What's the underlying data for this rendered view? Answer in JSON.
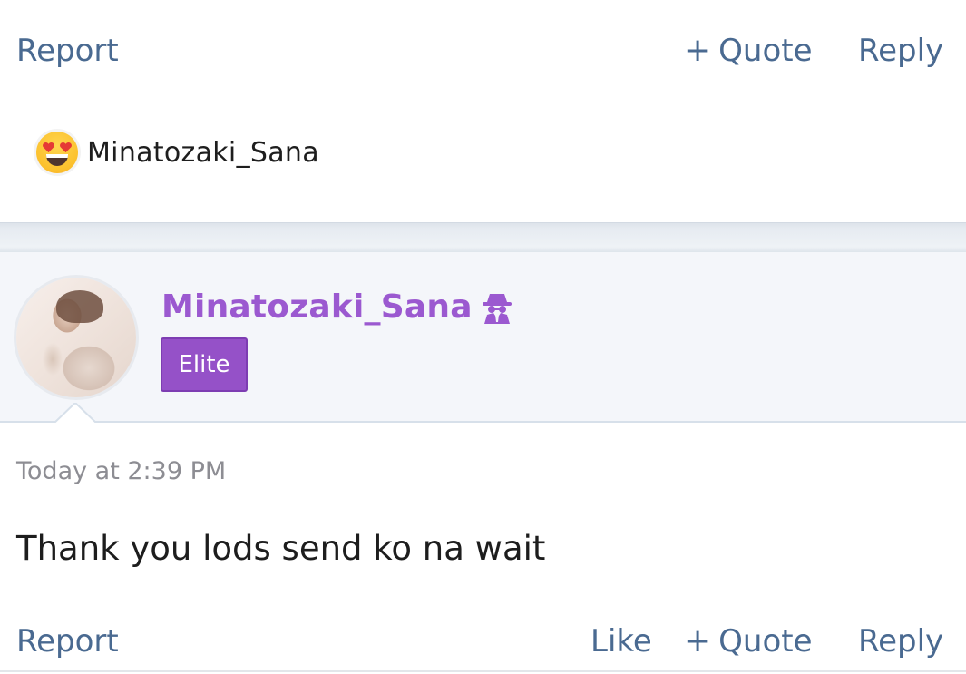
{
  "prev_post": {
    "actions": {
      "report": "Report",
      "quote": "Quote",
      "reply": "Reply"
    },
    "reaction": {
      "emoji": "heart-eyes",
      "username": "Minatozaki_Sana"
    }
  },
  "post": {
    "author": {
      "username": "Minatozaki_Sana",
      "icon": "spy-icon",
      "badge": "Elite"
    },
    "timestamp": "Today at 2:39 PM",
    "message": "Thank you lods send ko na wait",
    "actions": {
      "report": "Report",
      "like": "Like",
      "quote": "Quote",
      "reply": "Reply"
    }
  },
  "colors": {
    "link": "#4a6a91",
    "username": "#9b59d0",
    "badge_bg": "#9551c8",
    "header_bg": "#f4f6fa"
  }
}
